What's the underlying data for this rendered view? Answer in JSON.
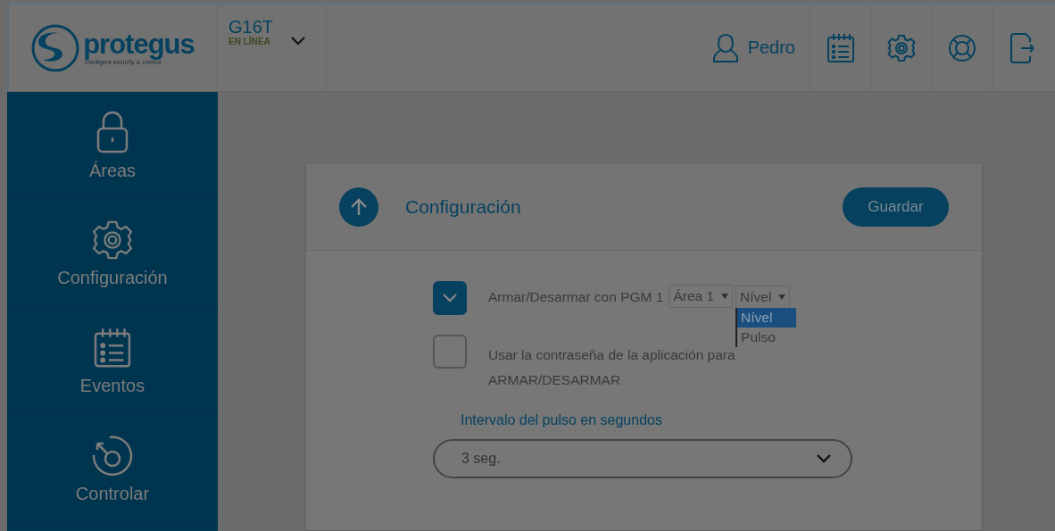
{
  "logo": {
    "name": "protegus",
    "tagline": "intelligent security & control"
  },
  "device": {
    "name": "G16T",
    "status": "EN LÍNEA"
  },
  "user": {
    "name": "Pedro"
  },
  "toolbar": [
    {
      "kind": "events"
    },
    {
      "kind": "settings"
    },
    {
      "kind": "help"
    },
    {
      "kind": "logout"
    }
  ],
  "sidebar": {
    "items": [
      {
        "label": "Áreas",
        "kind": "lock"
      },
      {
        "label": "Configuración",
        "kind": "gear"
      },
      {
        "label": "Eventos",
        "kind": "events"
      },
      {
        "label": "Controlar",
        "kind": "control"
      }
    ]
  },
  "card": {
    "title": "Configuración",
    "save_button": "Guardar",
    "options": [
      {
        "label": "Armar/Desarmar con PGM 1",
        "checked": true,
        "area_select": "Área 1",
        "mode_select": "Nível",
        "mode_options": [
          {
            "label": "Nível",
            "selected": true
          },
          {
            "label": "Pulso",
            "selected": false
          }
        ]
      },
      {
        "label": "Usar la contraseña de la aplicación para ARMAR/DESARMAR",
        "checked": false
      }
    ],
    "pulse_interval": {
      "label": "Intervalo del pulso en segundos",
      "value": "3 seg."
    }
  }
}
